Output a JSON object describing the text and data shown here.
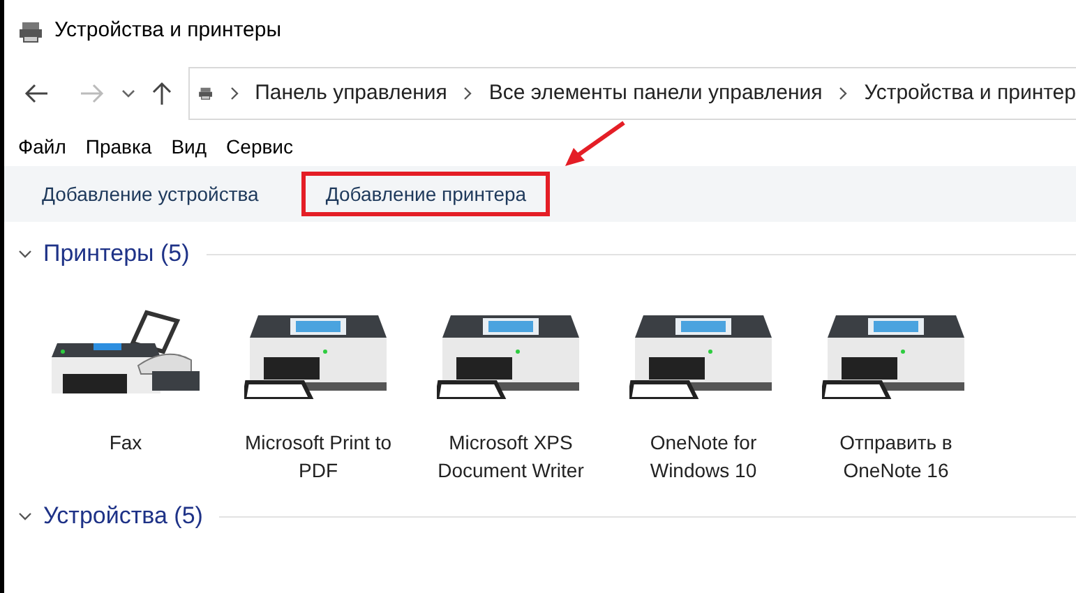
{
  "window": {
    "title": "Устройства и принтеры"
  },
  "address_bar": {
    "crumbs": [
      "Панель управления",
      "Все элементы панели управления",
      "Устройства и принтер"
    ]
  },
  "menu": [
    "Файл",
    "Правка",
    "Вид",
    "Сервис"
  ],
  "commands": [
    {
      "label": "Добавление устройства",
      "highlighted": false
    },
    {
      "label": "Добавление принтера",
      "highlighted": true
    }
  ],
  "groups": [
    {
      "title": "Принтеры (5)",
      "expanded": true,
      "items": [
        {
          "kind": "fax",
          "label": "Fax"
        },
        {
          "kind": "printer",
          "label": "Microsoft Print to PDF"
        },
        {
          "kind": "printer",
          "label": "Microsoft XPS Document Writer"
        },
        {
          "kind": "printer",
          "label": "OneNote for Windows 10"
        },
        {
          "kind": "printer",
          "label": "Отправить в OneNote 16"
        }
      ]
    },
    {
      "title": "Устройства (5)",
      "expanded": true
    }
  ]
}
